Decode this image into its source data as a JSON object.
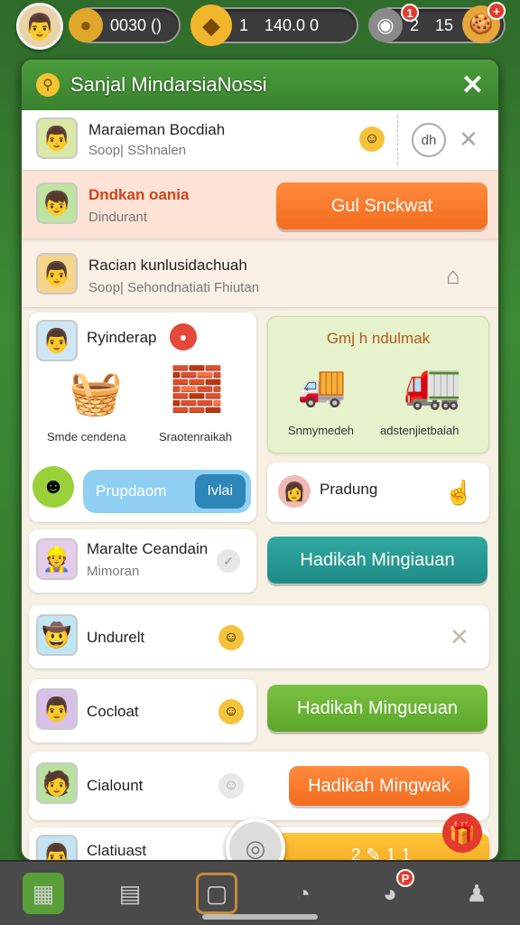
{
  "topbar": {
    "avatar_icon": "player-avatar",
    "coins": {
      "icon": "coin-icon",
      "value": "0030 ()"
    },
    "gems": {
      "icon": "gem-icon",
      "prefix": "1",
      "value": "140.0 0"
    },
    "orbs": {
      "icon": "orb-icon",
      "badge": "1",
      "prefix": "2",
      "value": "15",
      "extra_badge": "+"
    }
  },
  "panel": {
    "title": "Sanjal MindarsiaNossi",
    "close_label": "✕"
  },
  "rows": [
    {
      "name": "Maraieman Bocdiah",
      "sub": "Soop| SShnalen",
      "action_label": "dh"
    },
    {
      "name": "Dndkan oania",
      "sub": "Dindurant",
      "button": "Gul Snckwat"
    },
    {
      "name": "Racian kunlusidachuah",
      "sub": "Soop| Sehondnatiati Fhiutan"
    },
    {
      "name": "Ryinderap",
      "item1": "Smde cendena",
      "item2": "Sraotenraikah"
    },
    {
      "title": "Gmj h ndulmak",
      "item1": "Snmymedeh",
      "item2": "adstenjietbaiah"
    },
    {
      "pill_left": "Prupdaom",
      "pill_right": "Ivlai"
    },
    {
      "name": "Pradung"
    },
    {
      "name": "Maralte Ceandain",
      "sub": "Mimoran",
      "button": "Hadikah Mingiauan"
    },
    {
      "name": "Undurelt"
    },
    {
      "name": "Cocloat",
      "button": "Hadikah Mingueuan"
    },
    {
      "name": "Cialount",
      "button": "Hadikah Mingwak"
    },
    {
      "name": "Clatiuast",
      "button": "2 ✎ 1 1"
    }
  ],
  "colors": {
    "orange": "#f26c1e",
    "teal": "#1f8c86",
    "green": "#5aa62a",
    "header_green": "#3a822f"
  },
  "bottomnav": [
    "map-icon",
    "clipboard-icon",
    "frame-icon",
    "cart-icon",
    "profile-badge-icon",
    "person-icon"
  ],
  "bottomnav_badge": "P"
}
